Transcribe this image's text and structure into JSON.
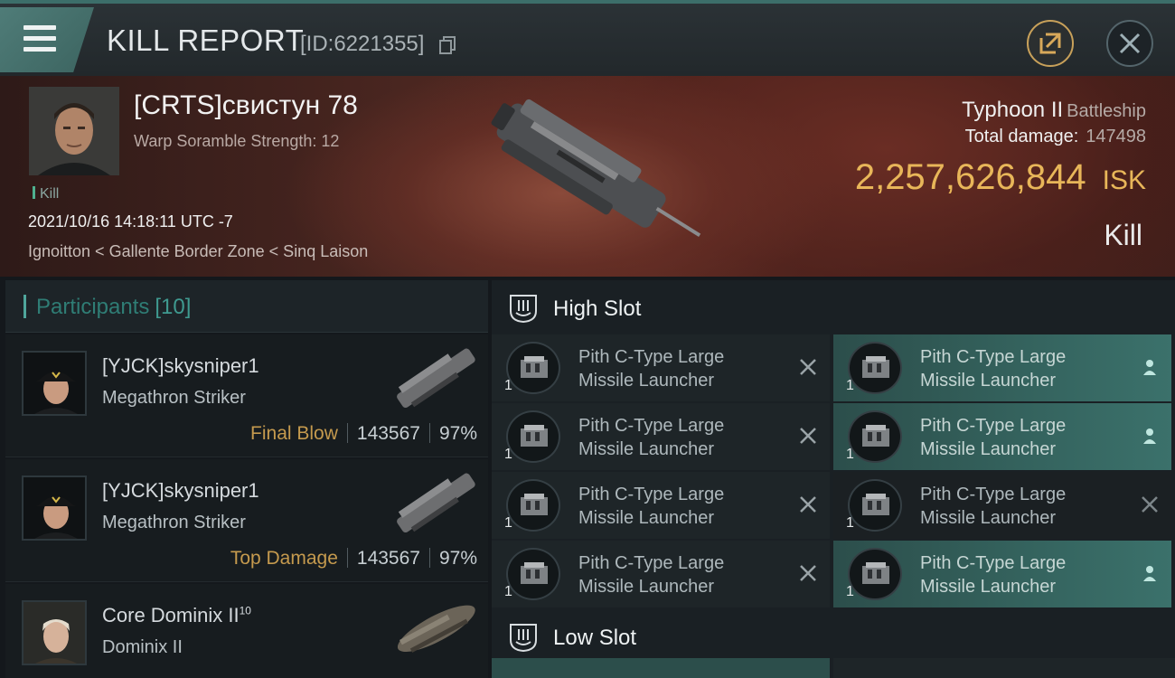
{
  "header": {
    "title": "KILL REPORT",
    "report_id": "[ID:6221355]"
  },
  "victim": {
    "name": "[CRTS]свистун 78",
    "warp_scramble": "Warp Soramble Strength: 12",
    "tag": "Kill",
    "datetime": "2021/10/16 14:18:11 UTC -7",
    "location": "Ignoitton < Gallente Border Zone < Sinq Laison",
    "ship_name": "Typhoon II",
    "ship_class": "Battleship",
    "total_damage_label": "Total damage:",
    "total_damage_value": "147498",
    "isk_value": "2,257,626,844",
    "isk_unit": "ISK",
    "result": "Kill"
  },
  "participants": {
    "label": "Participants",
    "count": "[10]",
    "rows": [
      {
        "name": "[YJCK]skysniper1",
        "ship": "Megathron Striker",
        "role": "Final Blow",
        "damage": "143567",
        "percent": "97%"
      },
      {
        "name": "[YJCK]skysniper1",
        "ship": "Megathron Striker",
        "role": "Top Damage",
        "damage": "143567",
        "percent": "97%"
      },
      {
        "name": "Core Dominix II",
        "name_sup": "10",
        "ship": "Dominix II"
      }
    ]
  },
  "slots": {
    "high_label": "High Slot",
    "low_label": "Low Slot",
    "high_modules": [
      {
        "line1": "Pith C-Type Large",
        "line2": "Missile Launcher",
        "qty": "1",
        "status": "destroyed"
      },
      {
        "line1": "Pith C-Type Large",
        "line2": "Missile Launcher",
        "qty": "1",
        "status": "dropped"
      },
      {
        "line1": "Pith C-Type Large",
        "line2": "Missile Launcher",
        "qty": "1",
        "status": "destroyed"
      },
      {
        "line1": "Pith C-Type Large",
        "line2": "Missile Launcher",
        "qty": "1",
        "status": "dropped"
      },
      {
        "line1": "Pith C-Type Large",
        "line2": "Missile Launcher",
        "qty": "1",
        "status": "destroyed"
      },
      {
        "line1": "Pith C-Type Large",
        "line2": "Missile Launcher",
        "qty": "1",
        "status": "destroyed"
      },
      {
        "line1": "Pith C-Type Large",
        "line2": "Missile Launcher",
        "qty": "1",
        "status": "destroyed"
      },
      {
        "line1": "Pith C-Type Large",
        "line2": "Missile Launcher",
        "qty": "1",
        "status": "dropped"
      }
    ]
  },
  "colors": {
    "accent_teal": "#4fa69c",
    "isk_gold": "#e8b659",
    "role_gold": "#c59a4e"
  }
}
